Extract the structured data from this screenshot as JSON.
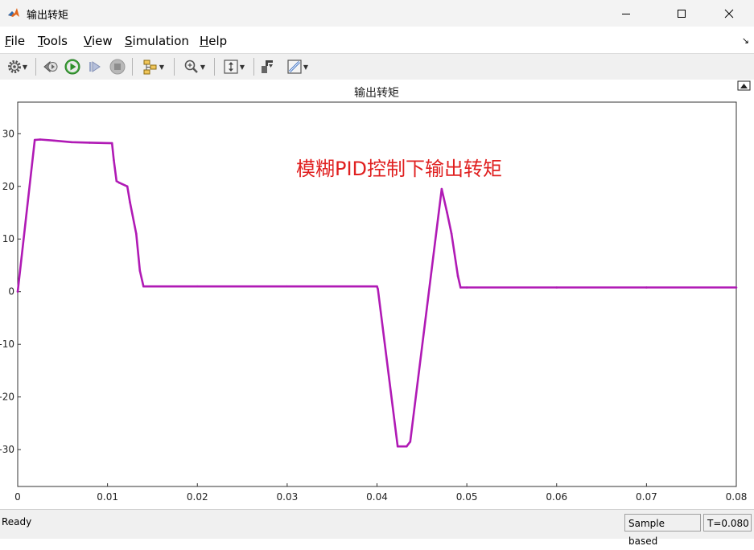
{
  "window": {
    "title": "输出转矩"
  },
  "menu": [
    {
      "label": "File",
      "u": "F",
      "rest": "ile"
    },
    {
      "label": "Tools",
      "u": "T",
      "rest": "ools"
    },
    {
      "label": "View",
      "u": "V",
      "rest": "iew"
    },
    {
      "label": "Simulation",
      "u": "S",
      "rest": "imulation"
    },
    {
      "label": "Help",
      "u": "H",
      "rest": "elp"
    }
  ],
  "toolbar": {
    "icons": [
      "gear-icon",
      "step-back-icon",
      "run-icon",
      "step-forward-icon",
      "stop-icon",
      "signal-select-icon",
      "zoom-icon",
      "fit-icon",
      "restore-layout-icon",
      "style-icon"
    ]
  },
  "colors": {
    "trace": "#b01ab5",
    "annotation": "#e02020",
    "grid": "#d4d4d4",
    "axes": "#333333"
  },
  "plot": {
    "title": "输出转矩",
    "annotation": "模糊PID控制下输出转矩"
  },
  "chart_data": {
    "type": "line",
    "title": "输出转矩",
    "xlabel": "",
    "ylabel": "",
    "xlim": [
      0,
      0.08
    ],
    "ylim": [
      -37,
      36
    ],
    "xticks": [
      0,
      0.01,
      0.02,
      0.03,
      0.04,
      0.05,
      0.06,
      0.07,
      0.08
    ],
    "xtick_labels": [
      "0",
      "0.01",
      "0.02",
      "0.03",
      "0.04",
      "0.05",
      "0.06",
      "0.07",
      "0.08"
    ],
    "yticks": [
      30,
      20,
      10,
      0,
      -10,
      -20,
      -30
    ],
    "ytick_labels": [
      "30",
      "20",
      "10",
      "0",
      "-10",
      "-20",
      "-30"
    ],
    "grid": true,
    "series": [
      {
        "x": [
          0,
          0.0019,
          0.0025,
          0.004,
          0.006,
          0.008,
          0.0105,
          0.0107,
          0.011,
          0.0113,
          0.0122,
          0.0125,
          0.0132,
          0.0136,
          0.014,
          0.02,
          0.03,
          0.04,
          0.0401,
          0.0423,
          0.0433,
          0.0437,
          0.0472,
          0.0478,
          0.0483,
          0.049,
          0.0493,
          0.05,
          0.06,
          0.07,
          0.08
        ],
        "y": [
          0,
          28.8,
          28.9,
          28.7,
          28.4,
          28.3,
          28.2,
          25,
          21,
          20.7,
          20,
          17,
          11,
          4,
          1,
          1,
          1,
          1,
          0.5,
          -29.4,
          -29.4,
          -28.5,
          19.5,
          15,
          11,
          3,
          0.8,
          0.8,
          0.8,
          0.8,
          0.8
        ]
      }
    ]
  },
  "status": {
    "ready": "Ready",
    "sample": "Sample based",
    "time": "T=0.080"
  }
}
